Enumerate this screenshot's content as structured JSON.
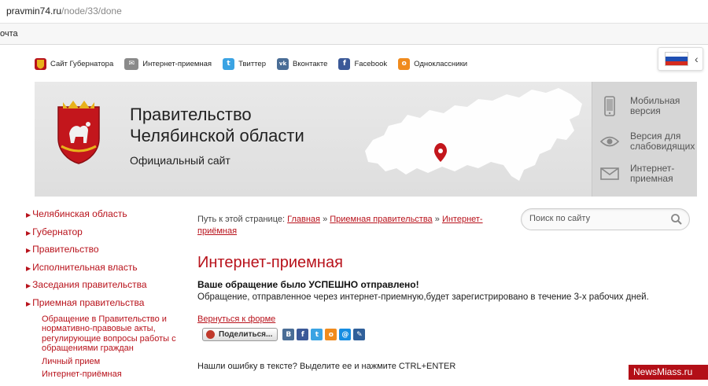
{
  "browser": {
    "url_domain": "pravmin74.ru",
    "url_path": "/node/33/done",
    "bookmark": "очта"
  },
  "topbar": {
    "links": [
      {
        "label": "Сайт Губернатора",
        "icon": "emblem-icon",
        "color": "#b8121b"
      },
      {
        "label": "Интернет-приемная",
        "icon": "envelope-icon",
        "color": "#777777"
      },
      {
        "label": "Твиттер",
        "icon": "twitter-icon",
        "color": "#3aa3e3"
      },
      {
        "label": "Вконтакте",
        "icon": "vk-icon",
        "color": "#4a6d96"
      },
      {
        "label": "Facebook",
        "icon": "facebook-icon",
        "color": "#3b5998"
      },
      {
        "label": "Одноклассники",
        "icon": "odnoklassniki-icon",
        "color": "#f08b1d"
      }
    ],
    "language_flag": "russia-flag-icon"
  },
  "header": {
    "title_line1": "Правительство",
    "title_line2": "Челябинской области",
    "subtitle": "Официальный сайт",
    "side_items": [
      {
        "label": "Мобильная версия",
        "icon": "mobile-icon"
      },
      {
        "label": "Версия для слабовидящих",
        "icon": "eye-icon"
      },
      {
        "label": "Интернет-приемная",
        "icon": "envelope-icon"
      }
    ]
  },
  "nav": {
    "items": [
      "Челябинская область",
      "Губернатор",
      "Правительство",
      "Исполнительная власть",
      "Заседания правительства",
      "Приемная правительства"
    ],
    "sub_items": [
      "Обращение в Правительство и нормативно-правовые акты, регулирующие вопросы работы с обращениями граждан",
      "Личный прием",
      "Интернет-приёмная"
    ]
  },
  "breadcrumb": {
    "prefix": "Путь к этой странице:",
    "items": [
      "Главная",
      "Приемная правительства",
      "Интернет-приёмная"
    ],
    "separator": "»"
  },
  "search": {
    "placeholder": "Поиск по сайту"
  },
  "main": {
    "title": "Интернет-приемная",
    "success": "Ваше обращение было УСПЕШНО отправлено!",
    "text": "Обращение, отправленное через интернет-приемную,будет зарегистрировано в течение 3-х рабочих дней.",
    "back_link": "Вернуться к форме",
    "share_label": "Поделиться...",
    "error_hint": "Нашли ошибку в тексте? Выделите ее и нажмите CTRL+ENTER"
  },
  "share_icons": [
    {
      "glyph": "В",
      "name": "vk-share-icon",
      "color": "#4a6d96"
    },
    {
      "glyph": "f",
      "name": "facebook-share-icon",
      "color": "#3b5998"
    },
    {
      "glyph": "t",
      "name": "twitter-share-icon",
      "color": "#3aa3e3"
    },
    {
      "glyph": "о",
      "name": "odnoklassniki-share-icon",
      "color": "#f08b1d"
    },
    {
      "glyph": "@",
      "name": "mailru-share-icon",
      "color": "#168de2"
    },
    {
      "glyph": "✎",
      "name": "livejournal-share-icon",
      "color": "#2f5f9a"
    }
  ],
  "watermark": "NewsMiass.ru",
  "colors": {
    "accent": "#b8121b",
    "header_bg": "#e4e4e4"
  }
}
